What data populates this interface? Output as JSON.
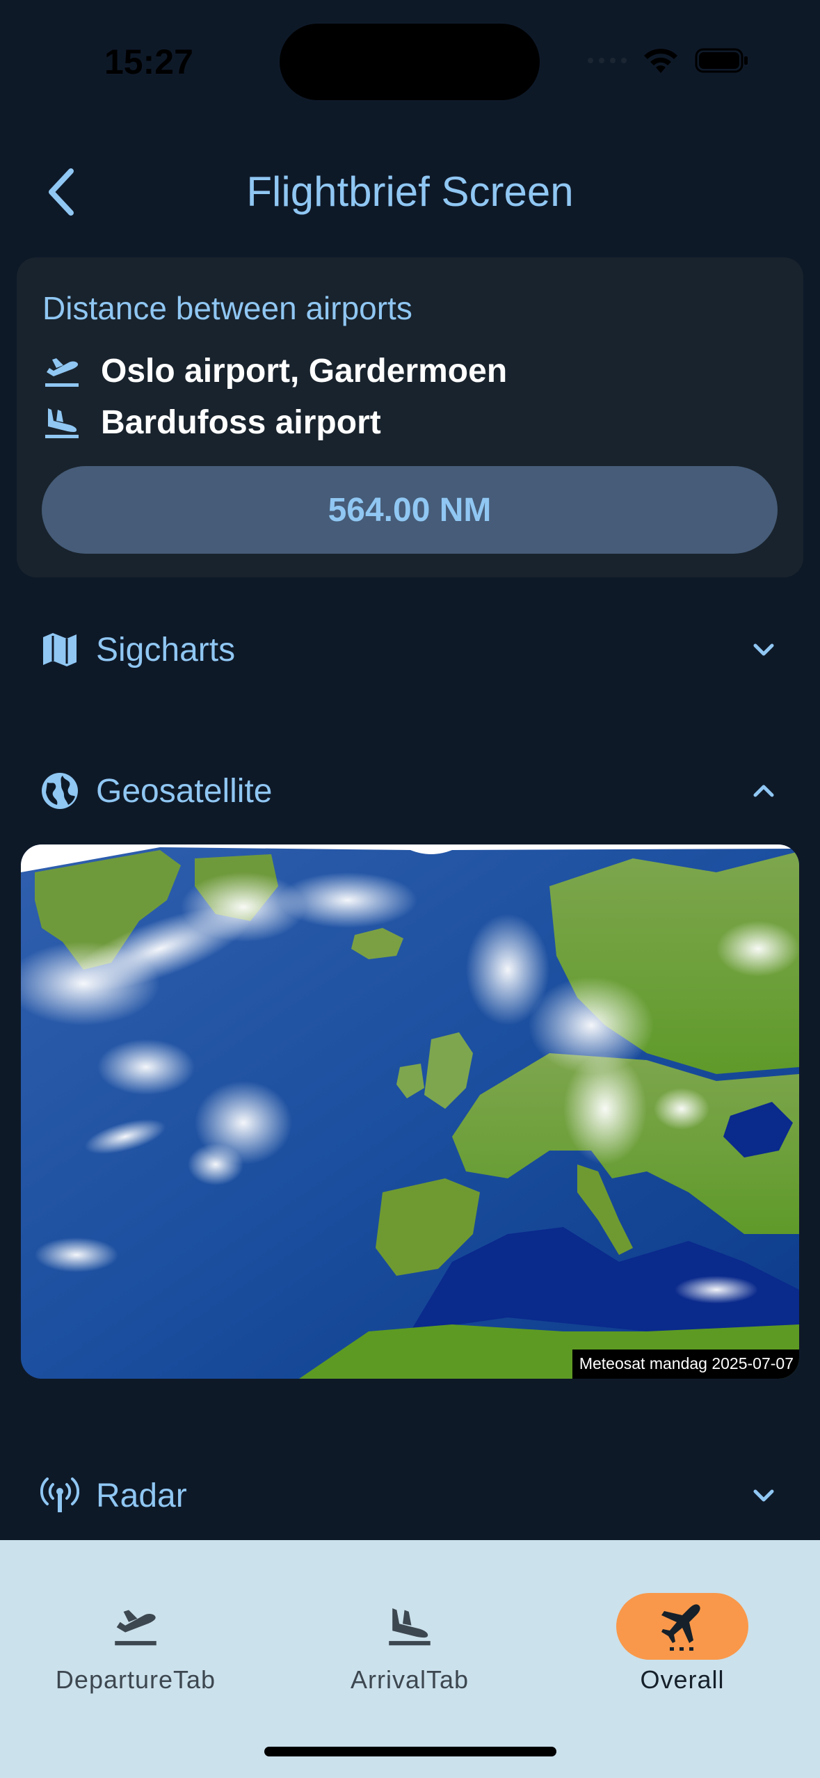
{
  "status_bar": {
    "time": "15:27"
  },
  "header": {
    "title": "Flightbrief Screen"
  },
  "distance_card": {
    "title": "Distance between airports",
    "departure_airport": "Oslo airport, Gardermoen",
    "arrival_airport": "Bardufoss airport",
    "distance": "564.00 NM"
  },
  "sections": [
    {
      "label": "Sigcharts",
      "expanded": false,
      "icon": "map-icon"
    },
    {
      "label": "Geosatellite",
      "expanded": true,
      "icon": "globe-icon"
    },
    {
      "label": "Radar",
      "expanded": false,
      "icon": "antenna-icon"
    }
  ],
  "satellite": {
    "caption": "Meteosat mandag 2025-07-07"
  },
  "bottom_nav": {
    "items": [
      {
        "label": "DepartureTab",
        "icon": "flight-takeoff-icon",
        "active": false
      },
      {
        "label": "ArrivalTab",
        "icon": "flight-land-icon",
        "active": false
      },
      {
        "label": "Overall",
        "icon": "airplane-icon",
        "active": true
      }
    ]
  },
  "colors": {
    "background": "#0e1928",
    "card": "#19232d",
    "accent": "#90c7f3",
    "pill": "#465c78",
    "nav_background": "#cbe1ec",
    "nav_active": "#f9984a"
  }
}
